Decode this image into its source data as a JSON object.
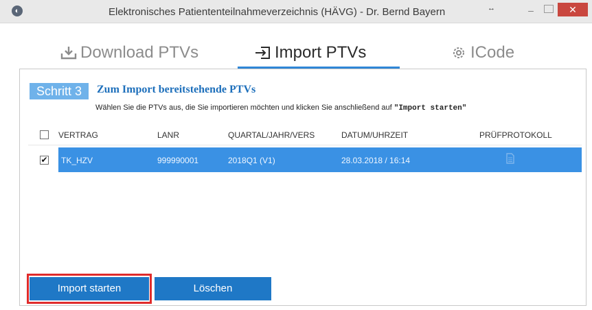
{
  "window": {
    "title": "Elektronisches Patiententeilnahmeverzeichnis (HÄVG) - Dr. Bernd Bayern",
    "resize_glyph": "↔",
    "minimize_glyph": "–",
    "close_glyph": "✕",
    "accent_color": "#c9473f"
  },
  "tabs": [
    {
      "label": "Download PTVs",
      "icon": "download-icon",
      "active": false
    },
    {
      "label": "Import PTVs",
      "icon": "import-icon",
      "active": true
    },
    {
      "label": "ICode",
      "icon": "gear-icon",
      "active": false
    }
  ],
  "step": {
    "badge": "Schritt 3",
    "heading": "Zum Import bereitstehende PTVs",
    "description_prefix": "Wählen Sie die PTVs aus, die Sie importieren möchten und klicken Sie anschließend auf ",
    "description_emph": "\"Import starten\""
  },
  "table": {
    "headers": {
      "vertrag": "VERTRAG",
      "lanr": "LANR",
      "quartal": "QUARTAL/JAHR/VERS",
      "datum": "DATUM/UHRZEIT",
      "pruef": "PRÜFPROTOKOLL"
    },
    "select_all_checked": false,
    "rows": [
      {
        "checked": true,
        "vertrag": "TK_HZV",
        "lanr": "999990001",
        "quartal": "2018Q1 (V1)",
        "datum": "28.03.2018 / 16:14",
        "pruef_icon": "document-icon",
        "selected": true
      }
    ],
    "selection_color": "#3a91e4"
  },
  "buttons": {
    "import": "Import starten",
    "loeschen": "Löschen",
    "primary_color": "#1f78c6",
    "highlight_color": "#e02b2b"
  }
}
